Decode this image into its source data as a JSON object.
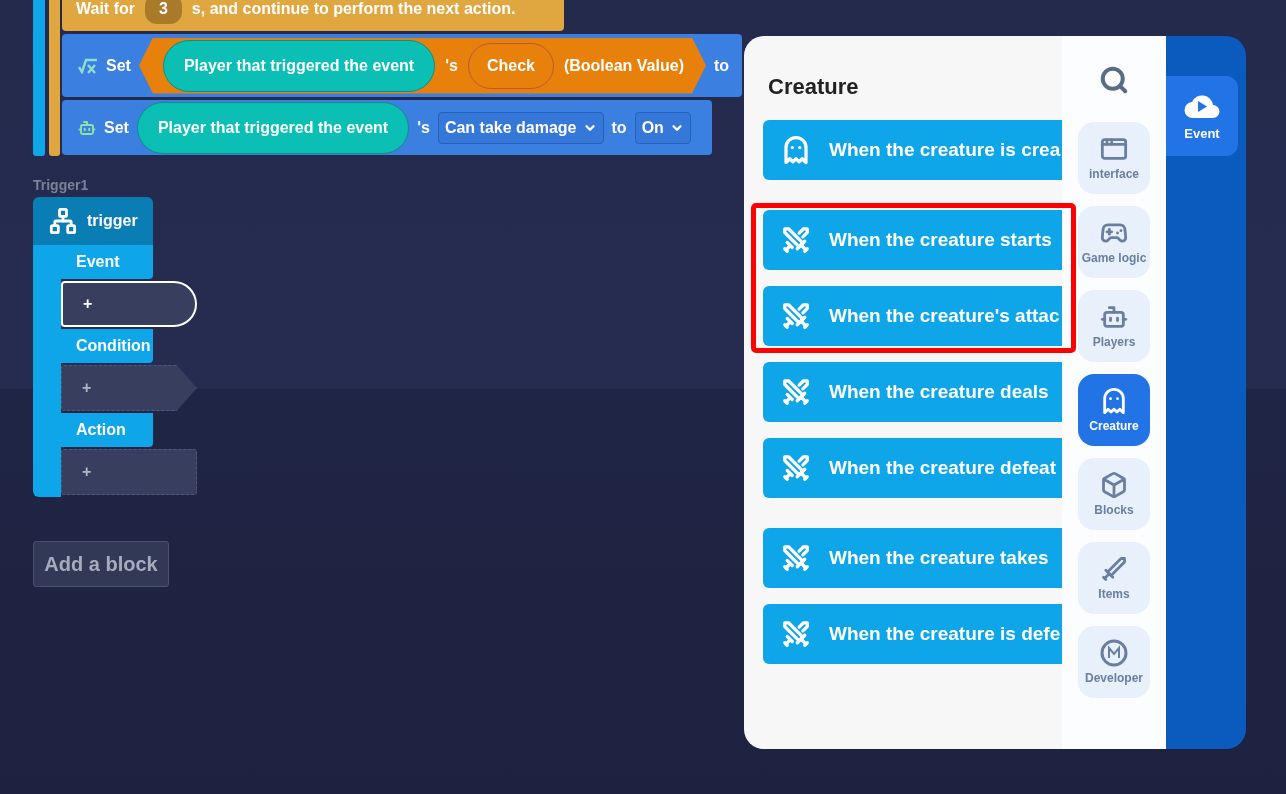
{
  "script": {
    "wait_block": {
      "label_before": "Wait for",
      "value": "3",
      "label_after": "s, and continue to perform the next action."
    },
    "set_blocks": [
      {
        "kind": "variable",
        "label": "Set",
        "target": "Player that triggered the event",
        "possessive": "'s",
        "property": "Check",
        "property_type": "(Boolean Value)",
        "to": "to"
      },
      {
        "kind": "attribute",
        "label": "Set",
        "target": "Player that triggered the event",
        "possessive": "'s",
        "property": "Can take damage",
        "to": "to",
        "value": "On"
      }
    ]
  },
  "trigger": {
    "name": "Trigger1",
    "title": "trigger",
    "sections": [
      {
        "kind": "event",
        "label": "Event",
        "slot": "+",
        "selected": true
      },
      {
        "kind": "condition",
        "label": "Condition",
        "slot": "+",
        "selected": false
      },
      {
        "kind": "action",
        "label": "Action",
        "slot": "+",
        "selected": false
      }
    ]
  },
  "add_block_button": "Add a block",
  "panel": {
    "title": "Creature",
    "sections": [
      [
        {
          "kind": "creature",
          "label": "When the creature is crea",
          "highlighted": false
        }
      ],
      [
        {
          "kind": "combat",
          "label": "When the creature starts",
          "highlighted": true
        },
        {
          "kind": "combat",
          "label": "When the creature's attac",
          "highlighted": true
        },
        {
          "kind": "combat",
          "label": "When the creature deals",
          "highlighted": false
        },
        {
          "kind": "combat",
          "label": "When the creature defeat",
          "highlighted": false
        }
      ],
      [
        {
          "kind": "combat",
          "label": "When the creature takes",
          "highlighted": false
        },
        {
          "kind": "combat",
          "label": "When the creature is defe",
          "highlighted": false
        }
      ]
    ],
    "categories": [
      {
        "kind": "interface",
        "label": "interface",
        "selected": false
      },
      {
        "kind": "game",
        "label": "Game logic",
        "selected": false
      },
      {
        "kind": "players",
        "label": "Players",
        "selected": false
      },
      {
        "kind": "creature",
        "label": "Creature",
        "selected": true
      },
      {
        "kind": "blocks",
        "label": "Blocks",
        "selected": false
      },
      {
        "kind": "items",
        "label": "Items",
        "selected": false
      },
      {
        "kind": "developer",
        "label": "Developer",
        "selected": false
      }
    ],
    "tabs": [
      {
        "label": "Event",
        "selected": true
      }
    ]
  }
}
